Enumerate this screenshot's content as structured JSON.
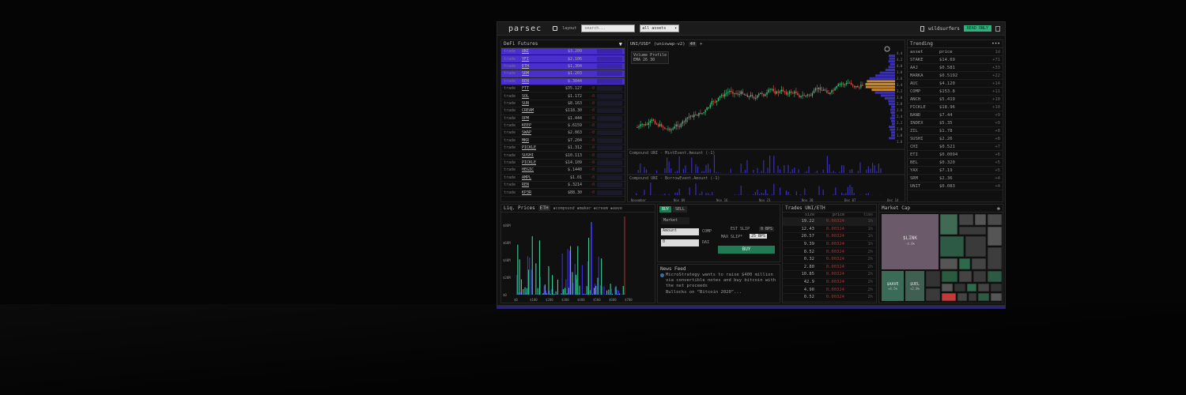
{
  "topbar": {
    "logo": "parsec",
    "layout_label": "layout",
    "search_placeholder": "search...",
    "select_value": "all assets",
    "user": "wildsurfers",
    "readonly": "READ ONLY"
  },
  "defi": {
    "title": "DeFi Futures",
    "trade_label": "trade",
    "rows": [
      {
        "sym": "UNI",
        "price": "$3.209",
        "chg": "",
        "sel": true
      },
      {
        "sym": "YFI",
        "price": "$2,106",
        "chg": "",
        "sel": true
      },
      {
        "sym": "ETH",
        "price": "$1,304",
        "chg": "",
        "sel": true
      },
      {
        "sym": "SRM",
        "price": "$1.203",
        "chg": "",
        "sel": true
      },
      {
        "sym": "REN",
        "price": "$.3044",
        "chg": "",
        "sel": true
      },
      {
        "sym": "FTT",
        "price": "$35.127",
        "chg": "-0",
        "sel": false
      },
      {
        "sym": "SOL",
        "price": "$1.172",
        "chg": "-0",
        "sel": false
      },
      {
        "sym": "SUN",
        "price": "$8.163",
        "chg": "-0",
        "sel": false
      },
      {
        "sym": "CREAM",
        "price": "$118.30",
        "chg": "-0",
        "sel": false
      },
      {
        "sym": "OPM",
        "price": "$1.444",
        "chg": "-0",
        "sel": false
      },
      {
        "sym": "KEEP",
        "price": "$.6159",
        "chg": "-0",
        "sel": false
      },
      {
        "sym": "SWAP",
        "price": "$2.063",
        "chg": "-0",
        "sel": false
      },
      {
        "sym": "MKR",
        "price": "$7.204",
        "chg": "-0",
        "sel": false
      },
      {
        "sym": "PICKLE",
        "price": "$1.312",
        "chg": "-0",
        "sel": false
      },
      {
        "sym": "SUSHI",
        "price": "$10.113",
        "chg": "-0",
        "sel": false
      },
      {
        "sym": "PICKLE",
        "price": "$14.109",
        "chg": "-0",
        "sel": false
      },
      {
        "sym": "HEGIC",
        "price": "$.1440",
        "chg": "-0",
        "sel": false
      },
      {
        "sym": "AMPL",
        "price": "$1.01",
        "chg": "-0",
        "sel": false
      },
      {
        "sym": "REN",
        "price": "$.3214",
        "chg": "-0",
        "sel": false
      },
      {
        "sym": "KP3R",
        "price": "$88.30",
        "chg": "-0",
        "sel": false
      }
    ]
  },
  "chart": {
    "pair": "UNI/USD* (uniswap-v2)",
    "interval": "4H",
    "volume_profile": "Volume Profile",
    "ema": "EMA 26 30",
    "sub1": "Compound UNI - MintEvent.Amount (-1)",
    "sub2": "Compound UNI - BorrowEvent.Amount (-1)",
    "xticks": [
      "November",
      "Nov 09",
      "Nov 16",
      "Nov 23",
      "Nov 30",
      "Dec 07",
      "Dec 14"
    ],
    "yticks": [
      "4.4",
      "4.2",
      "4.0",
      "3.8",
      "3.6",
      "3.4",
      "3.2",
      "3.0",
      "2.8",
      "2.6",
      "2.4",
      "2.2",
      "2.0",
      "1.8",
      "1.6"
    ],
    "sub_yticks": [
      "100K",
      "1.5M",
      "1.0M",
      "500K"
    ]
  },
  "trending": {
    "title": "Trending",
    "headers": [
      "asset",
      "price",
      "1d"
    ],
    "rows": [
      [
        "STAKE",
        "$14.69",
        "+71"
      ],
      [
        "AAJ",
        "$0.581",
        "+33"
      ],
      [
        "MARKA",
        "$0.5192",
        "+22"
      ],
      [
        "AUC",
        "$4.120",
        "+14"
      ],
      [
        "COMP",
        "$153.8",
        "+11"
      ],
      [
        "ANCH",
        "$5.419",
        "+10"
      ],
      [
        "PICKLE",
        "$18.96",
        "+10"
      ],
      [
        "BAND",
        "$7.44",
        "+9"
      ],
      [
        "INDEX",
        "$5.35",
        "+9"
      ],
      [
        "ZIL",
        "$1.78",
        "+8"
      ],
      [
        "SUSHI",
        "$2.26",
        "+8"
      ],
      [
        "CHI",
        "$0.521",
        "+7"
      ],
      [
        "ETI",
        "$0.0094",
        "+6"
      ],
      [
        "BEL",
        "$0.320",
        "+5"
      ],
      [
        "YAX",
        "$7.19",
        "+5"
      ],
      [
        "SRM",
        "$2.36",
        "+4"
      ],
      [
        "UNIT",
        "$0.083",
        "+4"
      ]
    ]
  },
  "liq": {
    "title": "Liq. Prices",
    "token": "ETH",
    "legend": "▪compound ▪maker ▪cream ▪aave",
    "yticks": [
      "$80M",
      "$60M",
      "$40M",
      "$20M",
      "$0"
    ],
    "xticks": [
      "$0",
      "$100",
      "$200",
      "$300",
      "$400",
      "$500",
      "$600",
      "$700"
    ]
  },
  "order": {
    "buy": "BUY",
    "sell": "SELL",
    "type": "Market",
    "amount_ph": "Amount",
    "comp": "COMP",
    "zero": "0",
    "dai": "DAI",
    "est_slip_label": "EST SLIP",
    "est_slip_val": "0 BPS",
    "max_slip_label": "MAX SLIP*",
    "max_slip_val": "25 BPS",
    "submit": "BUY"
  },
  "news": {
    "title": "News Feed",
    "items": [
      "MicroStrategy wants to raise $400 million via convertible notes and buy bitcoin with the net proceeds",
      "Bullocks on “Bitcoin 2020”..."
    ]
  },
  "trades": {
    "title": "Trades UNI/ETH",
    "headers": [
      "size",
      "price",
      "time"
    ],
    "rows": [
      [
        "19.22",
        "0.00324",
        "1h"
      ],
      [
        "12.43",
        "0.00324",
        "1h"
      ],
      [
        "20.57",
        "0.00324",
        "1h"
      ],
      [
        "9.39",
        "0.00324",
        "1h"
      ],
      [
        "8.52",
        "0.00324",
        "2h"
      ],
      [
        "0.32",
        "0.00324",
        "2h"
      ],
      [
        "2.80",
        "0.00324",
        "2h"
      ],
      [
        "10.85",
        "0.00324",
        "2h"
      ],
      [
        "42.9",
        "0.00324",
        "2h"
      ],
      [
        "4.90",
        "0.00324",
        "2h"
      ],
      [
        "0.52",
        "0.00324",
        "2h"
      ],
      [
        "0.41",
        "0.00324",
        "2h"
      ]
    ]
  },
  "marketcap": {
    "title": "Market Cap",
    "tiles": [
      {
        "label": "$LINK",
        "sub": "-4.0%"
      },
      {
        "label": "$AAVE",
        "sub": "+4.5%"
      },
      {
        "label": "$UEL",
        "sub": "+2.8%"
      }
    ]
  }
}
